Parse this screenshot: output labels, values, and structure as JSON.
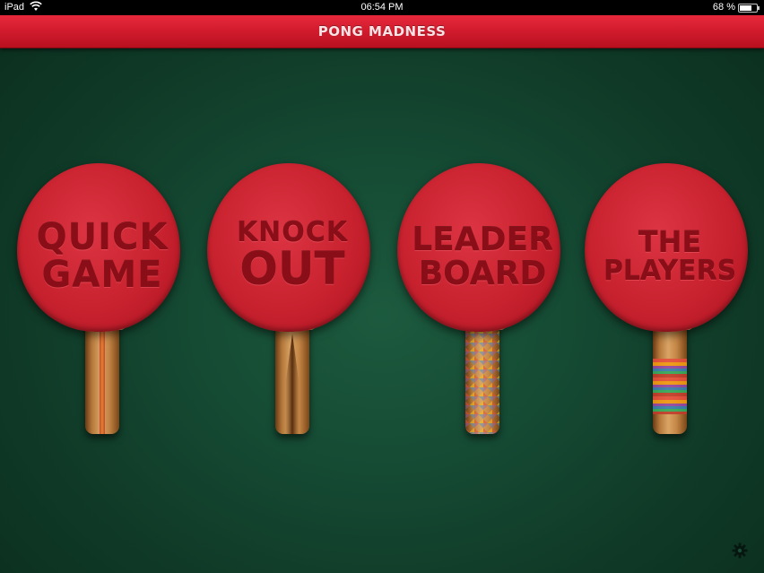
{
  "status_bar": {
    "carrier": "iPad",
    "time": "06:54 PM",
    "battery_percent": "68 %",
    "battery_level": 0.68
  },
  "nav": {
    "title": "PONG MADNESS"
  },
  "paddles": [
    {
      "line1": "QUICK",
      "line2": "GAME",
      "handle_style": "striped"
    },
    {
      "line1": "KNOCK",
      "line2": "OUT",
      "handle_style": "triangle"
    },
    {
      "line1": "LEADER",
      "line2": "BOARD",
      "handle_style": "mosaic"
    },
    {
      "line1": "THE",
      "line2": "PLAYERS",
      "handle_style": "bands"
    }
  ],
  "icons": {
    "settings": "gear-icon",
    "wifi": "wifi-icon",
    "battery": "battery-icon"
  },
  "colors": {
    "nav_red": "#d01b2d",
    "paddle_red": "#c9222f",
    "table_green": "#154a33"
  }
}
